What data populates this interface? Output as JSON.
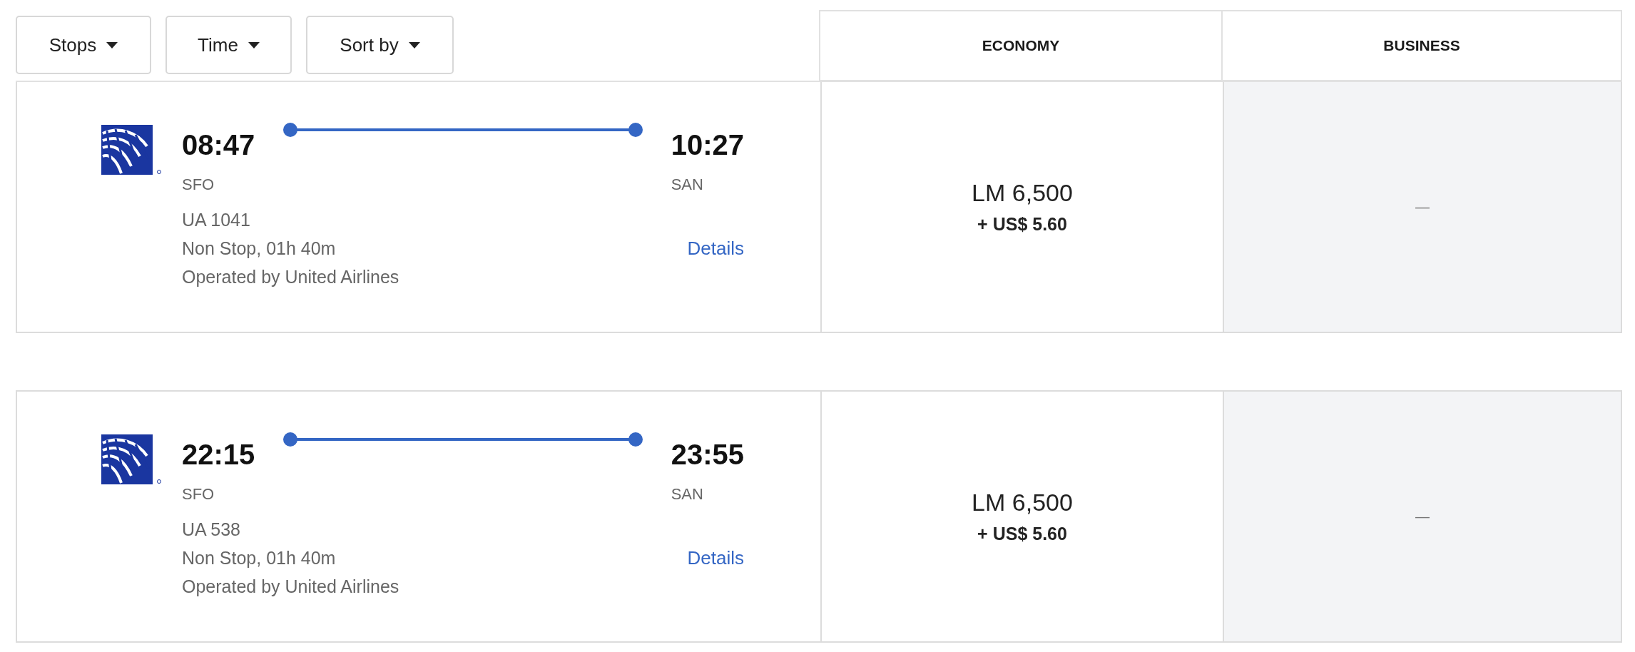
{
  "filters": [
    {
      "label": "Stops"
    },
    {
      "label": "Time"
    },
    {
      "label": "Sort by"
    }
  ],
  "cabin_columns": [
    "ECONOMY",
    "BUSINESS"
  ],
  "flights": [
    {
      "departure": {
        "time": "08:47",
        "airport": "SFO"
      },
      "arrival": {
        "time": "10:27",
        "airport": "SAN"
      },
      "flight_number": "UA 1041",
      "duration": "Non Stop, 01h 40m",
      "operator": "Operated by United Airlines",
      "details": "Details",
      "fares": [
        {
          "available": true,
          "price": "LM 6,500",
          "taxes": "+ US$ 5.60"
        },
        {
          "available": false,
          "text": "—"
        }
      ]
    },
    {
      "departure": {
        "time": "22:15",
        "airport": "SFO"
      },
      "arrival": {
        "time": "23:55",
        "airport": "SAN"
      },
      "flight_number": "UA 538",
      "duration": "Non Stop, 01h 40m",
      "operator": "Operated by United Airlines",
      "details": "Details",
      "fares": [
        {
          "available": true,
          "price": "LM 6,500",
          "taxes": "+ US$ 5.60"
        },
        {
          "available": false,
          "text": "—"
        }
      ]
    }
  ]
}
